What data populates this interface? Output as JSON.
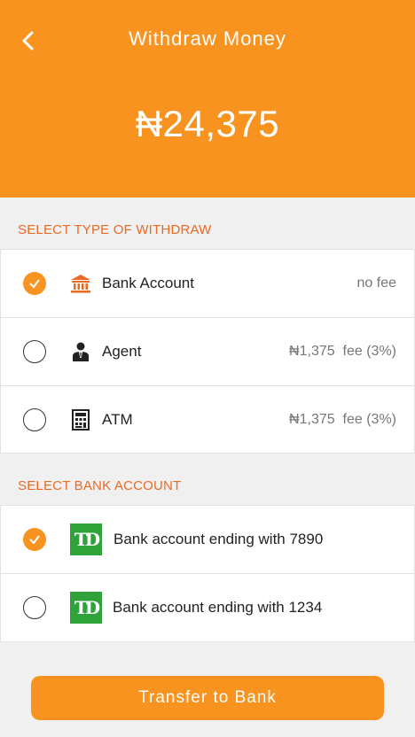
{
  "header": {
    "back_icon": "chevron-left-icon",
    "title": "Withdraw Money",
    "amount": "₦24,375"
  },
  "withdraw_type": {
    "section_label": "SELECT TYPE OF WITHDRAW",
    "options": [
      {
        "label": "Bank Account",
        "fee": "no fee",
        "icon": "bank-icon",
        "selected": true
      },
      {
        "label": "Agent",
        "fee": "₦1,375  fee (3%)",
        "icon": "agent-icon",
        "selected": false
      },
      {
        "label": "ATM",
        "fee": "₦1,375  fee (3%)",
        "icon": "calculator-icon",
        "selected": false
      }
    ]
  },
  "bank_account": {
    "section_label": "SELECT BANK ACCOUNT",
    "accounts": [
      {
        "label": "Bank account ending with 7890",
        "logo_text": "TD",
        "selected": true
      },
      {
        "label": "Bank account ending with 1234",
        "logo_text": "TD",
        "selected": false
      }
    ]
  },
  "cta": {
    "label": "Transfer to Bank"
  },
  "colors": {
    "accent": "#f7931e",
    "section_label": "#ea6a23",
    "td_green": "#2fa23a"
  }
}
